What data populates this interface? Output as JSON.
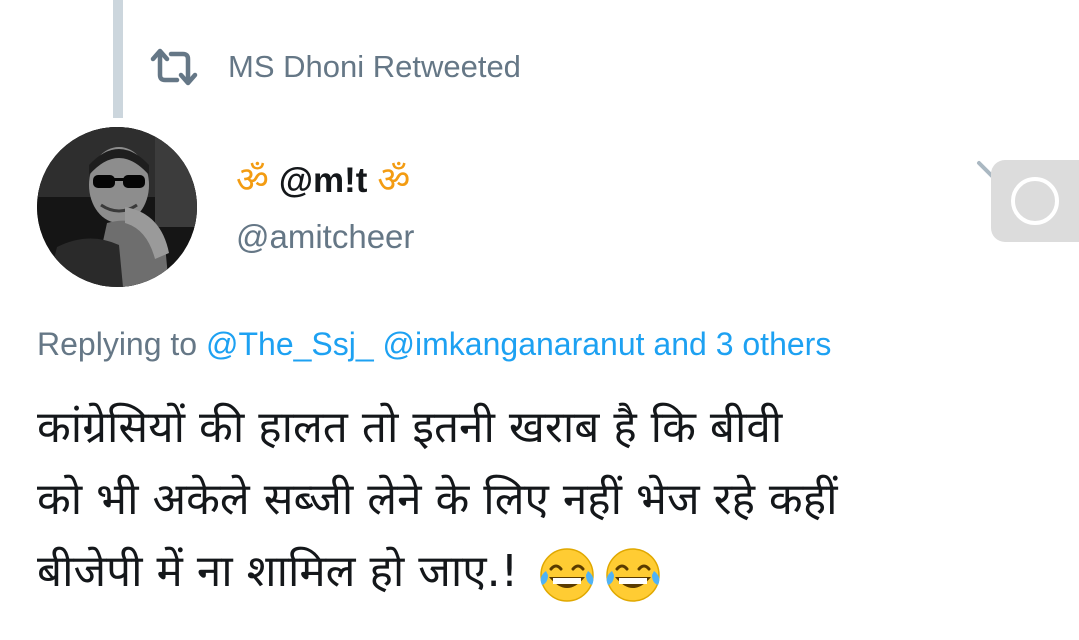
{
  "retweet": {
    "icon": "retweet-icon",
    "text": "MS Dhoni Retweeted"
  },
  "author": {
    "om_left": "ॐ",
    "name": "@m!t",
    "om_right": "ॐ",
    "handle": "@amitcheer",
    "avatar_icon": "avatar"
  },
  "menu": {
    "caret_icon": "chevron-down-icon"
  },
  "reply": {
    "prefix": "Replying to",
    "mentions": "@The_Ssj_ @imkanganaranut and 3 others"
  },
  "tweet": {
    "line1": "कांग्रेसियों की हालत तो इतनी खराब है कि बीवी",
    "line2": "को भी अकेले सब्जी लेने के लिए नहीं भेज रहे कहीं",
    "line3": "बीजेपी में ना शामिल हो जाए.!",
    "emoji": [
      "face-with-tears-of-joy-icon",
      "face-with-tears-of-joy-icon"
    ]
  },
  "colors": {
    "secondary_text": "#657786",
    "link": "#1da1f2",
    "primary_text": "#14171a",
    "thread_line": "#ccd6dd",
    "om": "#f39c12"
  }
}
